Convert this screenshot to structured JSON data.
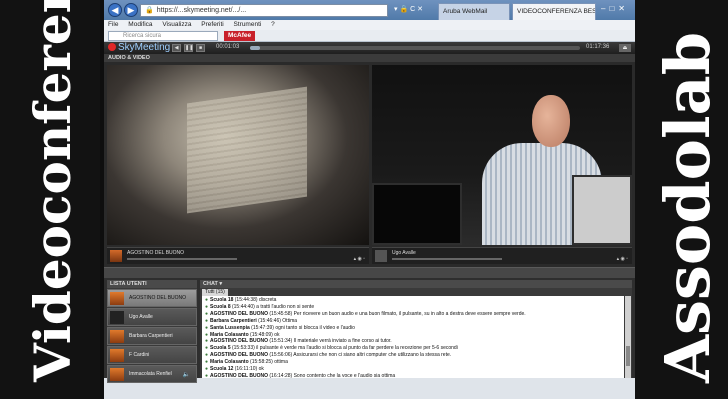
{
  "banner": {
    "left_text": "Videoconferenza",
    "right_text": "Assodolab"
  },
  "browser": {
    "address": "https://...skymeeting.net/.../...",
    "tools": "▾ 🔒 C ✕",
    "tabs": [
      {
        "label": "Aruba WebMail",
        "active": false
      },
      {
        "label": "VIDEOCONFERENZA BES...",
        "active": true
      }
    ],
    "menu": [
      "File",
      "Modifica",
      "Visualizza",
      "Preferiti",
      "Strumenti",
      "?"
    ],
    "search_placeholder": "Ricerca sicura",
    "mcafee_label": "McAfee"
  },
  "app": {
    "logo": "SkyMeeting",
    "elapsed": "00:01:03",
    "total": "01:17:36",
    "progress_fraction": 0.03,
    "section_av": "AUDIO & VIDEO",
    "video_left_name": "AGOSTINO DEL BUONO",
    "video_right_name": "Ugo Avalle",
    "users_title": "LISTA UTENTI",
    "users": [
      {
        "name": "AGOSTINO DEL BUONO",
        "active": true,
        "lit": true
      },
      {
        "name": "Ugo Avalle",
        "active": false,
        "lit": false
      },
      {
        "name": "Barbara Carpentieri",
        "active": false,
        "lit": true
      },
      {
        "name": "F Cardini",
        "active": false,
        "lit": true
      },
      {
        "name": "Immacolata Renfiel",
        "active": false,
        "lit": true
      }
    ],
    "chat_title": "CHAT ▾",
    "chat_tab": "Tutti (15)",
    "chat": [
      {
        "who": "Scuola 18",
        "time": "(15:44:38)",
        "msg": "discreta"
      },
      {
        "who": "Scuola 8",
        "time": "(15:44:40)",
        "msg": "a tratti l'audio non si sente"
      },
      {
        "who": "AGOSTINO DEL BUONO",
        "time": "(15:45:58)",
        "msg": "Per ricevere un buon audio e una buon filmato, il pulsante, su in alto a destra deve essere sempre verde."
      },
      {
        "who": "Barbara Carpentieri",
        "time": "(15:46:46)",
        "msg": "Ottima"
      },
      {
        "who": "Santa Lussenpia",
        "time": "(15:47:39)",
        "msg": "ogni tanto si blocca il video e l'audio"
      },
      {
        "who": "Maria Colasanto",
        "time": "(15:48:09)",
        "msg": "ok"
      },
      {
        "who": "AGOSTINO DEL BUONO",
        "time": "(15:51:34)",
        "msg": "Il materiale verrà inviato a fine corso ai tutor."
      },
      {
        "who": "Scuola 5",
        "time": "(15:53:33)",
        "msg": "il pulsante è verde ma l'audio si blocca al punto da far perdere la recezione per 5-6 secondi"
      },
      {
        "who": "AGOSTINO DEL BUONO",
        "time": "(15:56:06)",
        "msg": "Assicurarsi che non ci siano altri computer che utilizzano la stessa rete."
      },
      {
        "who": "Maria Colasanto",
        "time": "(15:58:25)",
        "msg": "ottima"
      },
      {
        "who": "Scuola 12",
        "time": "(16:11:10)",
        "msg": "ok"
      },
      {
        "who": "AGOSTINO DEL BUONO",
        "time": "(16:14:28)",
        "msg": "Sono contento che la voce e l'audio sia ottima"
      }
    ]
  }
}
